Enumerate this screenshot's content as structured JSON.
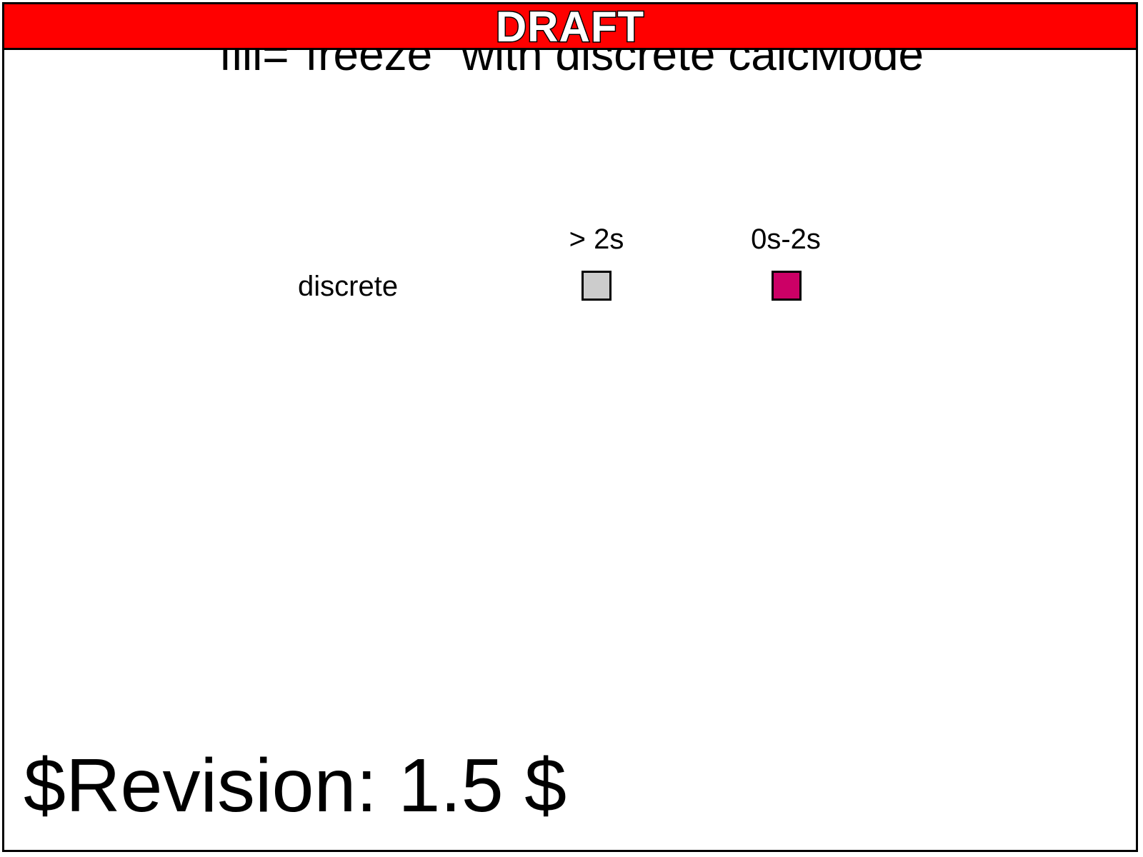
{
  "title": "fill=\"freeze\" with discrete calcMode",
  "banner": {
    "label": "DRAFT",
    "color": "#ff0000"
  },
  "grid": {
    "columns": [
      {
        "label": "> 2s",
        "swatch_color": "#cccccc"
      },
      {
        "label": "0s-2s",
        "swatch_color": "#cc0066"
      }
    ],
    "rows": [
      {
        "label": "discrete"
      }
    ]
  },
  "revision": "$Revision: 1.5 $"
}
